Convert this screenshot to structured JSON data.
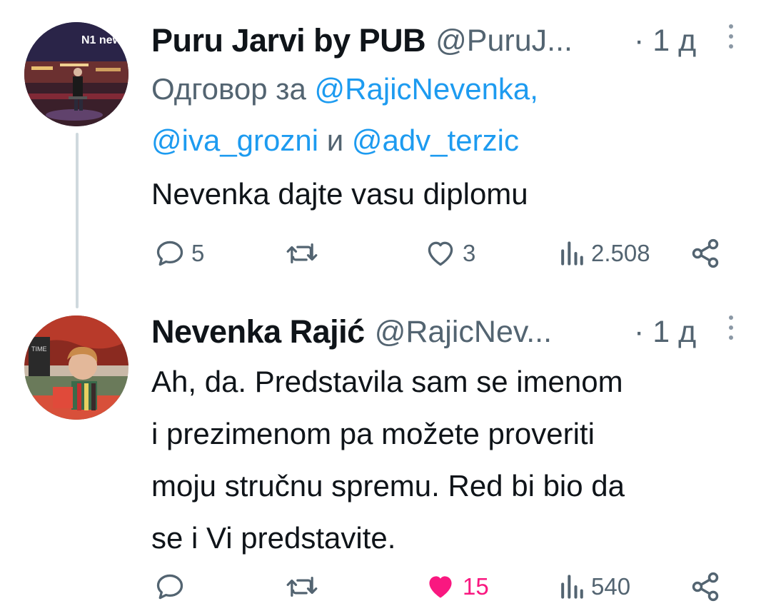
{
  "tweets": [
    {
      "author_name": "Puru Jarvi by PUB",
      "author_handle": "@PuruJ...",
      "time": "· 1 д",
      "reply_prefix": "Одговор за",
      "mention_1": "@RajicNevenka,",
      "mention_2": "@iva_grozni",
      "reply_and": "и",
      "mention_3": "@adv_terzic",
      "avatar_logo": "N1 news",
      "text_lines": [
        "Nevenka dajte vasu diplomu"
      ],
      "reply_count": "5",
      "retweet_count": "",
      "like_count": "3",
      "view_count": "2.508",
      "liked": false
    },
    {
      "author_name": "Nevenka Rajić",
      "author_handle": "@RajicNev...",
      "time": "· 1 д",
      "avatar_sign": "TIME",
      "text_lines": [
        "Ah, da. Predstavila sam se imenom",
        "i prezimenom pa možete proveriti",
        "moju stručnu spremu. Red bi bio da",
        "se i Vi predstavite."
      ],
      "reply_count": "",
      "retweet_count": "",
      "like_count": "15",
      "view_count": "540",
      "liked": true
    }
  ],
  "icons": {
    "reply": "reply-icon",
    "retweet": "retweet-icon",
    "like": "heart-icon",
    "views": "views-icon",
    "share": "share-icon",
    "more": "more-icon"
  },
  "colors": {
    "text": "#0f1419",
    "secondary": "#536471",
    "accent": "#1d9bf0",
    "like": "#f91880",
    "thread_line": "#cfd9de"
  }
}
